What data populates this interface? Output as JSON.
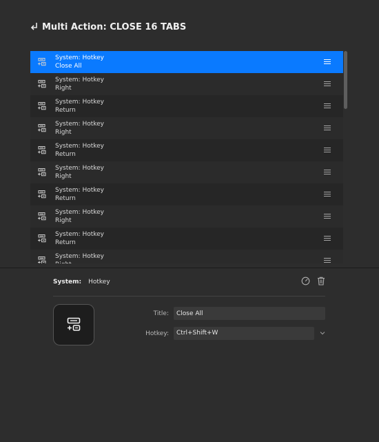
{
  "header": {
    "title": "Multi Action: CLOSE 16 TABS"
  },
  "list": {
    "items": [
      {
        "plugin": "System: Hotkey",
        "title": "Close All",
        "selected": true
      },
      {
        "plugin": "System: Hotkey",
        "title": "Right"
      },
      {
        "plugin": "System: Hotkey",
        "title": "Return"
      },
      {
        "plugin": "System: Hotkey",
        "title": "Right"
      },
      {
        "plugin": "System: Hotkey",
        "title": "Return"
      },
      {
        "plugin": "System: Hotkey",
        "title": "Right"
      },
      {
        "plugin": "System: Hotkey",
        "title": "Return"
      },
      {
        "plugin": "System: Hotkey",
        "title": "Right"
      },
      {
        "plugin": "System: Hotkey",
        "title": "Return"
      },
      {
        "plugin": "System: Hotkey",
        "title": "Right"
      }
    ]
  },
  "props": {
    "plugin_name": "System:",
    "action_name": "Hotkey",
    "title_label": "Title:",
    "title_value": "Close All",
    "hotkey_label": "Hotkey:",
    "hotkey_value": "Ctrl+Shift+W"
  },
  "colors": {
    "selection": "#0a7aff",
    "background": "#2d2d2d",
    "list_background": "#262626"
  },
  "icons": {
    "back": "return-arrow-icon",
    "row": "hotkey-icon",
    "drag": "drag-handle-icon",
    "behavior": "gauge-icon",
    "delete": "trash-icon",
    "dropdown": "chevron-down-icon"
  }
}
